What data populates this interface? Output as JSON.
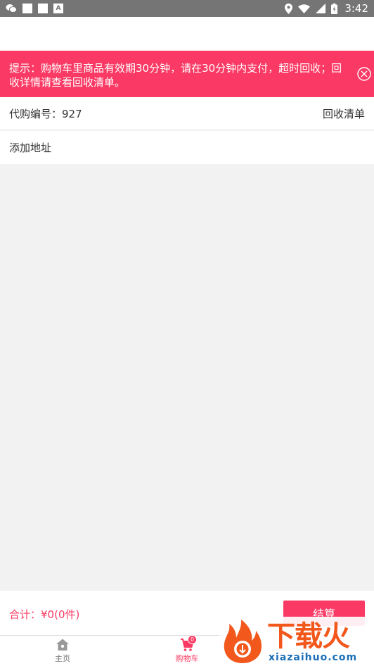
{
  "status_bar": {
    "time": "3:42",
    "icons": [
      "wechat-icon",
      "notification-square-icon",
      "notification-square-icon",
      "a-icon",
      "location-icon",
      "wifi-icon",
      "signal-icon",
      "battery-icon"
    ]
  },
  "notice": {
    "text": "提示：购物车里商品有效期30分钟，请在30分钟内支付，超时回收；回收详情请查看回收清单。",
    "close_icon": "close-circle-icon"
  },
  "order": {
    "number_label": "代购编号：927",
    "recycle_list_link": "回收清单"
  },
  "address": {
    "add_label": "添加地址"
  },
  "total_bar": {
    "total_text": "合计：¥0(0件)",
    "checkout_label": "结算"
  },
  "tab_bar": {
    "tabs": [
      {
        "label": "主页",
        "icon": "home-icon",
        "active": false
      },
      {
        "label": "购物车",
        "icon": "cart-icon",
        "active": true,
        "badge": "0"
      }
    ]
  },
  "watermark": {
    "title": "下载火",
    "url": "xiazaihuo.com"
  },
  "colors": {
    "accent": "#fa3a64",
    "status_bar": "#757575",
    "background": "#f2f2f2",
    "watermark_orange": "#f2571c",
    "watermark_blue": "#1a6fb8"
  }
}
